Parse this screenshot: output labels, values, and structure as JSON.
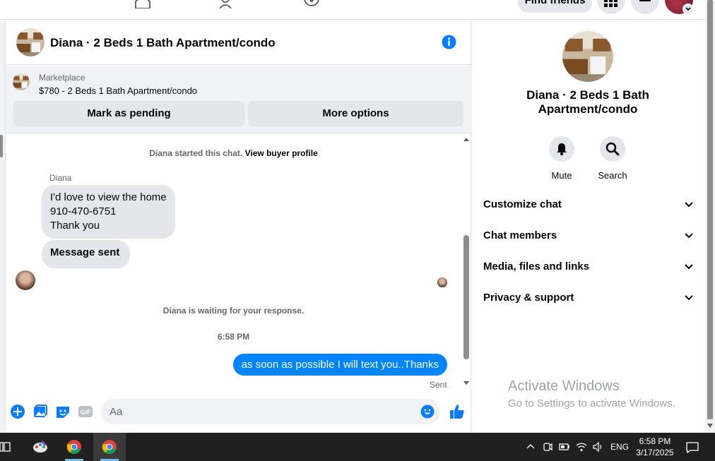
{
  "topnav": {
    "find_friends": "Find friends"
  },
  "chat": {
    "header_title": "Diana · 2 Beds 1 Bath Apartment/condo",
    "marketplace": {
      "label": "Marketplace",
      "listing": "$780 - 2 Beds 1 Bath Apartment/condo",
      "mark_pending": "Mark as pending",
      "more_options": "More options"
    },
    "started_text": "Diana started this chat.",
    "view_profile": "View buyer profile",
    "sender_name": "Diana",
    "message_1_lines": [
      "I'd love to view the home",
      "910-470-6751",
      "Thank you"
    ],
    "message_2": "Message sent",
    "waiting_text": "Diana is waiting for your response.",
    "time": "6:58 PM",
    "outgoing": "as soon as possible I will text you..Thanks",
    "sent": "Sent",
    "composer_placeholder": "Aa"
  },
  "info_panel": {
    "title": "Diana · 2 Beds 1 Bath Apartment/condo",
    "mute": "Mute",
    "search": "Search",
    "rows": [
      "Customize chat",
      "Chat members",
      "Media, files and links",
      "Privacy & support"
    ]
  },
  "watermark": {
    "line1": "Activate Windows",
    "line2": "Go to Settings to activate Windows."
  },
  "taskbar": {
    "lang": "ENG",
    "time": "6:58 PM",
    "date": "3/17/2025"
  },
  "colors": {
    "messenger_blue": "#0084ff",
    "bubble_gray": "#e4e6eb",
    "fb_blue": "#1877f2"
  }
}
